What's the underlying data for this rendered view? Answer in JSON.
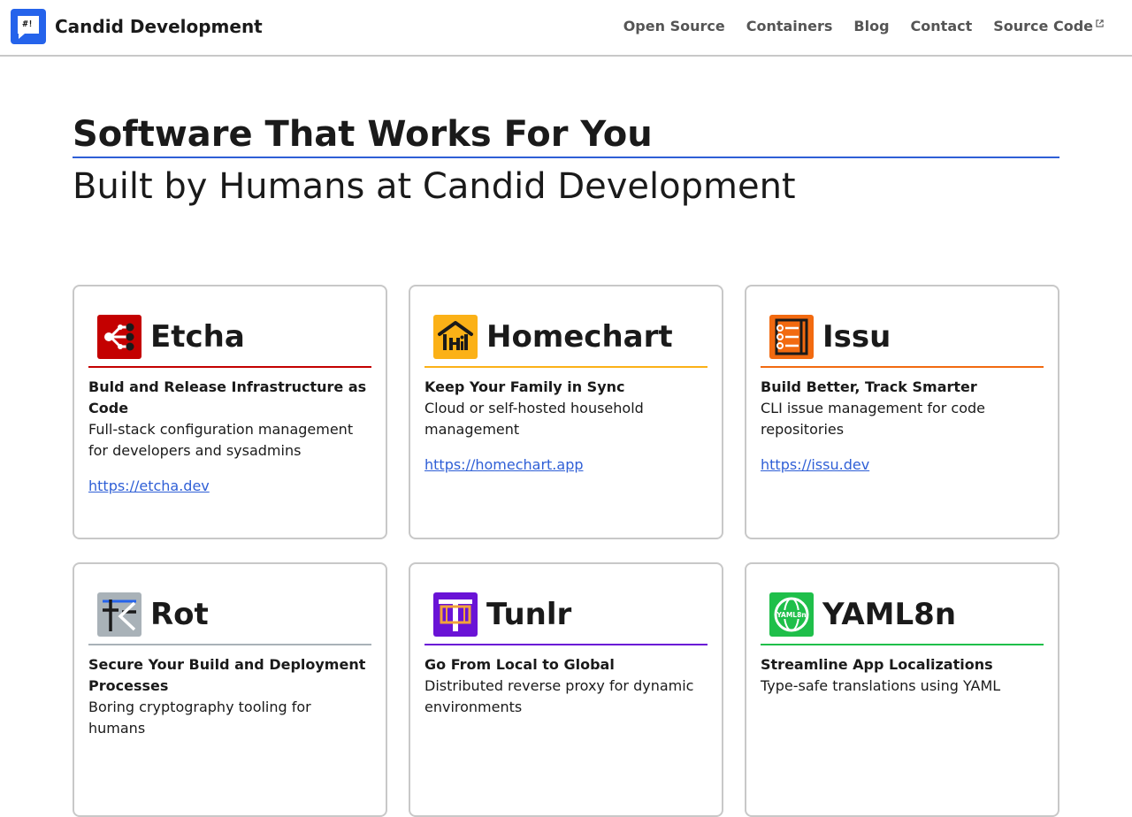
{
  "header": {
    "brand_name": "Candid Development",
    "logo_text": "#!",
    "nav": [
      {
        "label": "Open Source"
      },
      {
        "label": "Containers"
      },
      {
        "label": "Blog"
      },
      {
        "label": "Contact"
      },
      {
        "label": "Source Code",
        "external": true
      }
    ]
  },
  "hero": {
    "title": "Software That Works For You",
    "subtitle": "Built by Humans at Candid Development"
  },
  "colors": {
    "link": "#2f5fd6",
    "brand": "#2563eb",
    "etcha": "#c40000",
    "homechart": "#fbb117",
    "issu": "#f26a10",
    "rot": "#a9b2b8",
    "tunlr": "#6a13d6",
    "yaml8n": "#1fbf4a"
  },
  "products": [
    {
      "name": "Etcha",
      "icon": "etcha-share-icon",
      "tagline": "Buld and Release Infrastructure as Code",
      "description": "Full-stack configuration management for developers and sysadmins",
      "link": "https://etcha.dev"
    },
    {
      "name": "Homechart",
      "icon": "homechart-house-icon",
      "tagline": "Keep Your Family in Sync",
      "description": "Cloud or self-hosted household management",
      "link": "https://homechart.app"
    },
    {
      "name": "Issu",
      "icon": "issu-list-icon",
      "tagline": "Build Better, Track Smarter",
      "description": "CLI issue management for code repositories",
      "link": "https://issu.dev"
    },
    {
      "name": "Rot",
      "icon": "rot-cipher-icon",
      "tagline": "Secure Your Build and Deployment Processes",
      "description": "Boring cryptography tooling for humans",
      "link": ""
    },
    {
      "name": "Tunlr",
      "icon": "tunlr-tunnel-icon",
      "tagline": "Go From Local to Global",
      "description": "Distributed reverse proxy for dynamic environments",
      "link": ""
    },
    {
      "name": "YAML8n",
      "icon": "yaml8n-globe-icon",
      "tagline": "Streamline App Localizations",
      "description": "Type-safe translations using YAML",
      "link": ""
    }
  ]
}
